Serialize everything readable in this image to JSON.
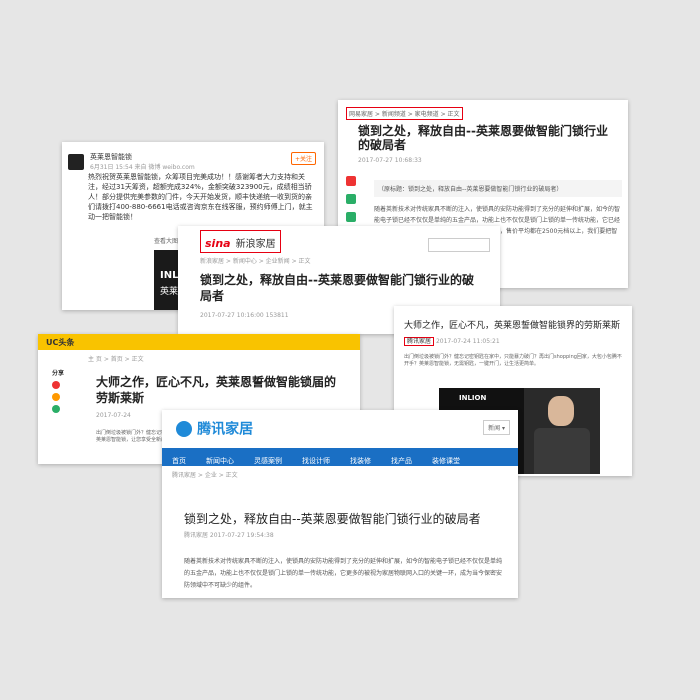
{
  "card1": {
    "name": "英莱恩智能锁",
    "meta": "6月31日 15:54 来自 微博 weibo.com",
    "follow": "+关注",
    "text": "热烈祝贺英莱恩智能锁，众筹项目完美成功！！感谢筹者大力支持和关注，经过31天筹资，超额完成324%，金额突破323900元，成绩相当骄人！部分提供完美参数的门件，今天开始发货，顺丰快递统一收到货的亲们请拨打400-880-6661电话或咨询京东在线客服，预约师傅上门，就主动一把智能锁！",
    "tabs": "查看大图  向左",
    "img_t1": "INLION",
    "img_t2": "英莱恩智能锁"
  },
  "card2": {
    "breadcrumb": "网易家居 > 新闻频道 > 家电频道 > 正文",
    "title": "锁到之处，释放自由--英莱恩要做智能门锁行业的破局者",
    "meta": "2017-07-27 10:68:33",
    "quote": "（原标题：锁到之处，释放自由--英莱恩要做智能门锁行业的破局者）",
    "body": "随着英新技术对传统家具不断的注入，使锁具的安防功能得到了充分的延伸和扩展，如今的智能电子锁已经不仅仅是单纯的五金产品，功能上也不仅仅是锁门上锁的单一传统功能，它已经成为物联网入口的关键一环。随着一国家千万量，售价平均都在2500元档以上，我们要把智能锁推广到每家每户..."
  },
  "card3": {
    "logo_a": "sina",
    "logo_b": "新浪家居",
    "nav": "新浪家居 > 新闻中心 > 企业新闻 > 正文",
    "title": "锁到之处，释放自由--英莱恩要做智能门锁行业的破局者",
    "meta": "2017-07-27 10:16:00     153811"
  },
  "card4": {
    "brand": "UC头条",
    "breadcrumb": "主 页 > 首页 > 正文",
    "share": "分享",
    "title": "大师之作，匠心不凡，英莱恩誓做智能锁届的劳斯莱斯",
    "meta": "2017-07-24",
    "body": "出门倒垃圾被锁门外？健忘记密钥匙在家中。只能以暴力破门的方式回家？我们的英莱恩智能锁，让您享受全新的智能生活..."
  },
  "card5": {
    "title": "大师之作，匠心不凡，英莱恩誓做智能锁界的劳斯莱斯",
    "source": "腾讯家居",
    "time": "2017-07-24 11:05:21",
    "body": "出门倒垃圾被锁门外？健忘记密钥匙在家中，只能暴力破门？再出门shopping回家，大包小包腾不开手？英莱恩智能锁，无需钥匙，一键开门，让生活更简单。",
    "pic_brand": "INLION"
  },
  "card6": {
    "logo": "腾讯家居",
    "search": "新闻 ▾",
    "nav": [
      "首页",
      "新闻中心",
      "灵感案例",
      "找设计师",
      "找装修",
      "找产品",
      "装修课堂"
    ],
    "breadcrumb": "腾讯家居 > 企业 > 正文",
    "title": "锁到之处，释放自由--英莱恩要做智能门锁行业的破局者",
    "meta": "腾讯家居   2017-07-27 19:54:38",
    "body": "随着英新技术对传统家具不断的注入，使锁具的安防功能得到了充分的延伸和扩展，如今的智能电子锁已经不仅仅是单纯的五金产品，功能上也不仅仅是锁门上锁的单一传统功能，它更多的被视为家居物联网入口的关键一环，成为当今保密安防领域中不可缺少的组件。"
  }
}
